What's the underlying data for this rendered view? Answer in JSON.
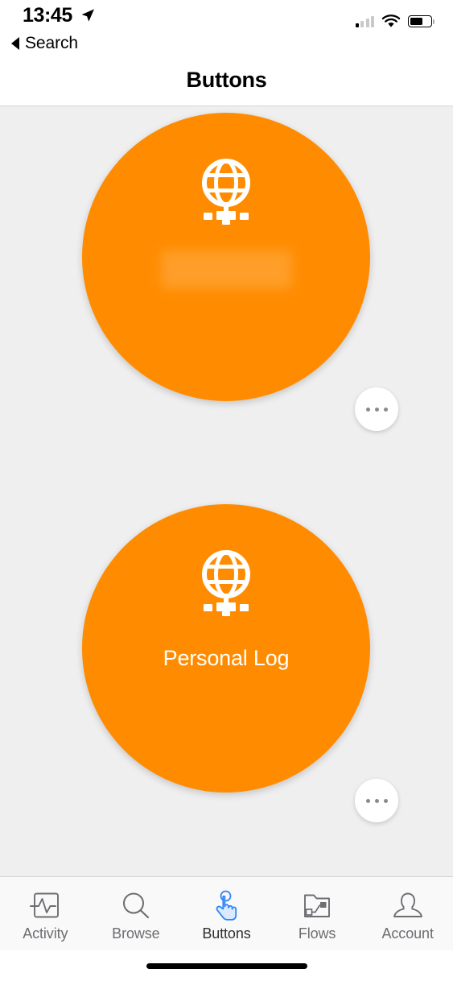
{
  "status_bar": {
    "time": "13:45",
    "location_icon": "location-arrow-icon",
    "signal_icon": "cellular-signal-icon",
    "signal_bars_active": 1,
    "signal_bars_total": 4,
    "wifi_icon": "wifi-icon",
    "battery_icon": "battery-icon",
    "battery_level_percent": 62
  },
  "navigation": {
    "back_label": "Search",
    "back_icon": "back-triangle-icon",
    "title": "Buttons"
  },
  "theme": {
    "accent_orange": "#ff8c00",
    "page_background": "#efeff0",
    "tab_active_blue": "#2f86f6",
    "tab_inactive_gray": "#6d6d72",
    "white": "#ffffff"
  },
  "buttons": [
    {
      "icon": "globe-stand-icon",
      "label": "",
      "label_redacted": true,
      "more_label": "More options"
    },
    {
      "icon": "globe-stand-icon",
      "label": "Personal Log",
      "label_redacted": false,
      "more_label": "More options"
    }
  ],
  "tab_bar": {
    "tabs": [
      {
        "label": "Activity",
        "icon": "activity-pulse-icon",
        "active": false
      },
      {
        "label": "Browse",
        "icon": "magnifier-icon",
        "active": false
      },
      {
        "label": "Buttons",
        "icon": "tap-hand-icon",
        "active": true
      },
      {
        "label": "Flows",
        "icon": "folder-flow-icon",
        "active": false
      },
      {
        "label": "Account",
        "icon": "person-icon",
        "active": false
      }
    ]
  },
  "home_indicator": "home-bar"
}
